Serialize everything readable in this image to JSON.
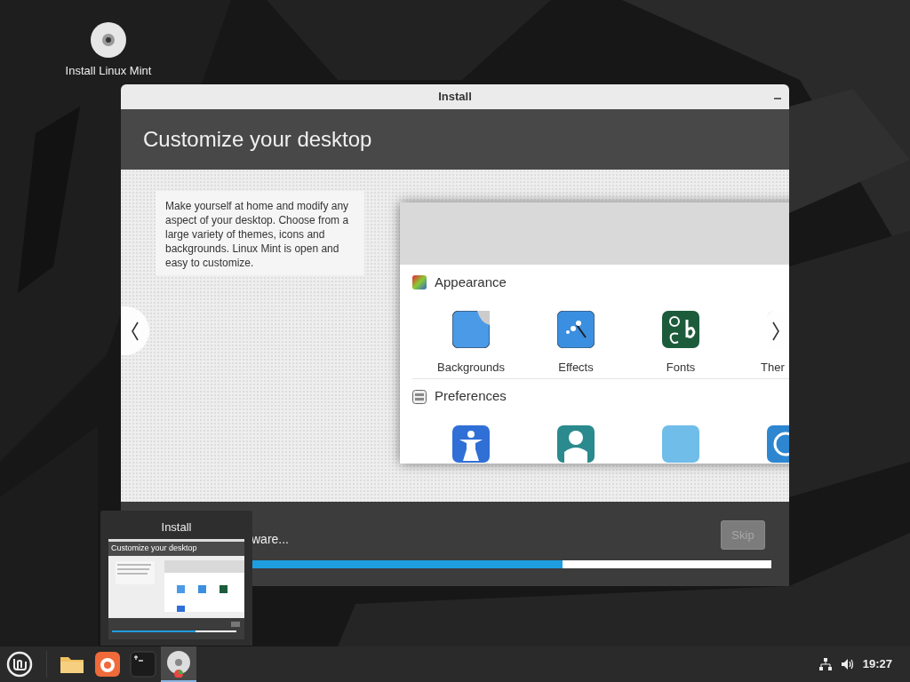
{
  "desktop_icons": [
    {
      "label": "Install Linux Mint"
    }
  ],
  "window": {
    "title": "Install",
    "header": "Customize your desktop",
    "description": "Make yourself at home and modify any aspect of your desktop. Choose from a large variety of themes, icons and backgrounds. Linux Mint is open and easy to customize.",
    "slide": {
      "sections": [
        {
          "title": "Appearance",
          "kind": "appearance",
          "items": [
            {
              "label": "Backgrounds",
              "kind": "backgrounds"
            },
            {
              "label": "Effects",
              "kind": "effects"
            },
            {
              "label": "Fonts",
              "kind": "fonts"
            },
            {
              "label": "Ther",
              "kind": "themes"
            }
          ]
        },
        {
          "title": "Preferences",
          "kind": "preferences",
          "items": [
            {
              "kind": "accessibility"
            },
            {
              "kind": "account"
            },
            {
              "kind": "blank"
            },
            {
              "kind": "clock"
            }
          ]
        }
      ]
    },
    "status": "ware...",
    "progress": {
      "level": 0.67
    },
    "skip_button": {
      "label": "Skip",
      "disabled": true
    }
  },
  "preview": {
    "title": "Install",
    "thumbnail_title": "Customize your desktop"
  },
  "taskbar": {
    "apps": [
      {
        "kind": "files",
        "selected": false
      },
      {
        "kind": "browser",
        "selected": false
      },
      {
        "kind": "terminal",
        "selected": false
      },
      {
        "kind": "disc",
        "selected": true
      }
    ],
    "clock": "19:27"
  }
}
